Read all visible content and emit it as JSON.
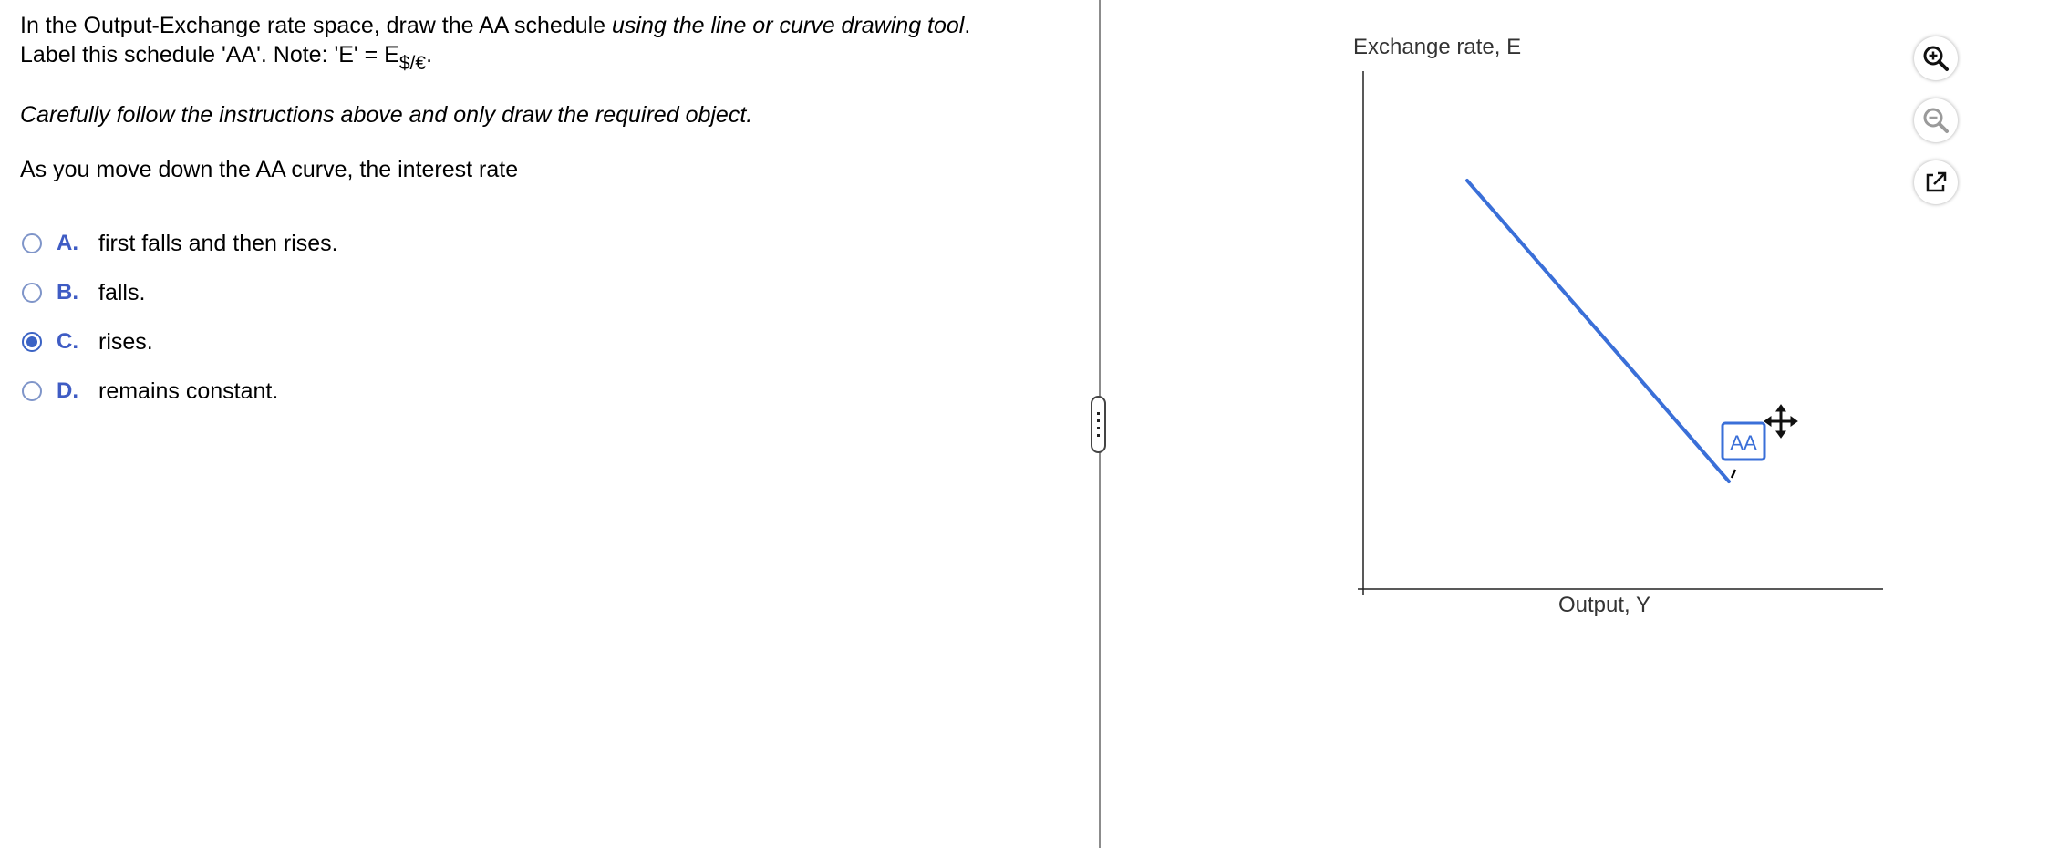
{
  "question": {
    "line1_prefix": "In the Output-Exchange rate space, draw the AA schedule ",
    "line1_italic": "using the line or curve drawing tool",
    "line1_suffix": ".",
    "line2_prefix": "Label this schedule 'AA'. Note: 'E' =  E",
    "line2_sub": "$/€",
    "line2_suffix": ".",
    "instruction": "Carefully follow the instructions above and only draw the required object.",
    "prompt": "As you move down the AA curve, the interest rate"
  },
  "options": [
    {
      "letter": "A.",
      "text": "first falls and then rises.",
      "selected": false
    },
    {
      "letter": "B.",
      "text": "falls.",
      "selected": false
    },
    {
      "letter": "C.",
      "text": "rises.",
      "selected": true
    },
    {
      "letter": "D.",
      "text": "remains constant.",
      "selected": false
    }
  ],
  "graph": {
    "y_axis_label": "Exchange rate, E",
    "x_axis_label": "Output, Y",
    "curve_label": "AA",
    "curve_color": "#3a6fd8",
    "tools": [
      "zoom-in-icon",
      "zoom-out-icon",
      "popout-icon"
    ]
  }
}
